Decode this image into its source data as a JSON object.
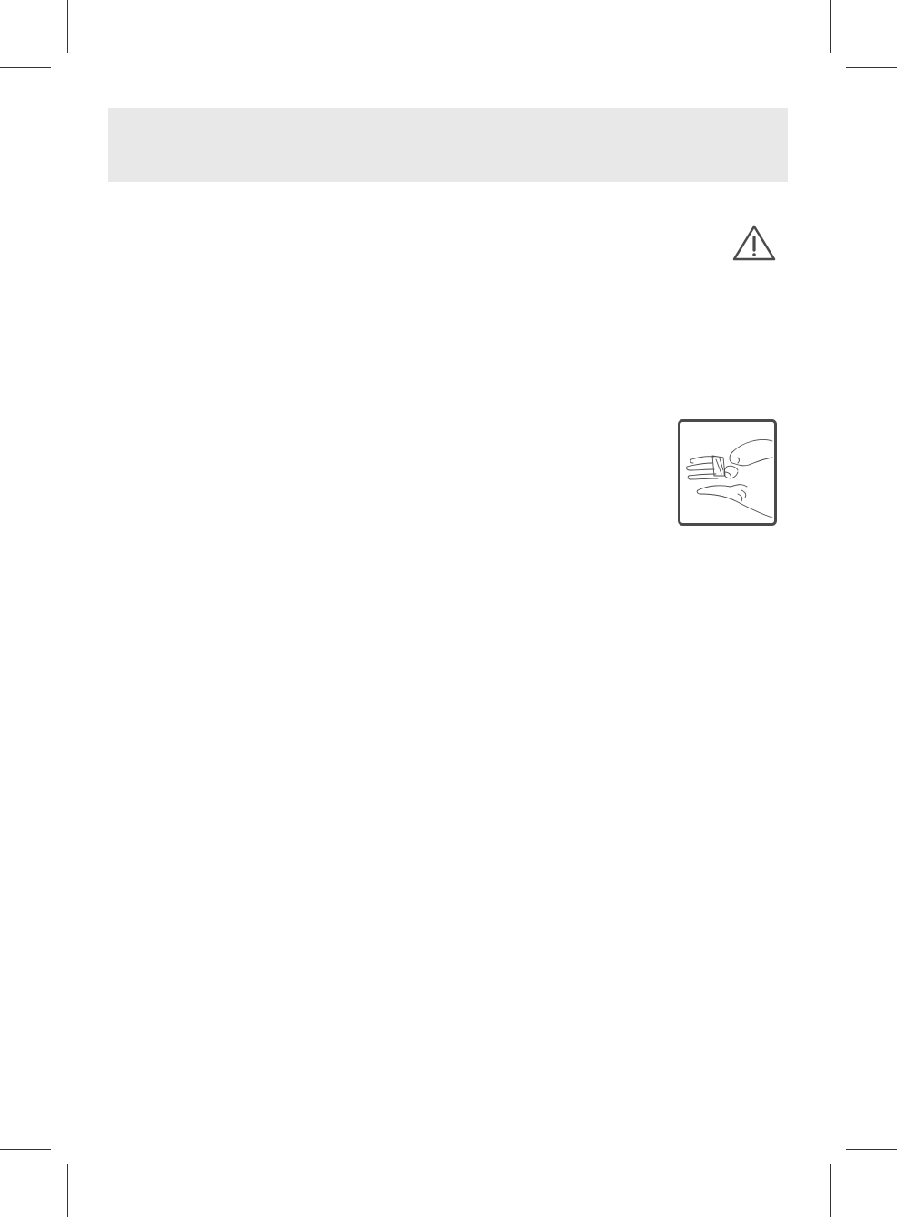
{
  "page": {
    "header_band_color": "#e8e8e8",
    "background_color": "#ffffff"
  },
  "icons": {
    "warning": "warning-triangle-icon",
    "illustration": "hands-applying-bandage-illustration"
  },
  "colors": {
    "line": "#4a4a4a",
    "crop_marks": "#333333"
  }
}
